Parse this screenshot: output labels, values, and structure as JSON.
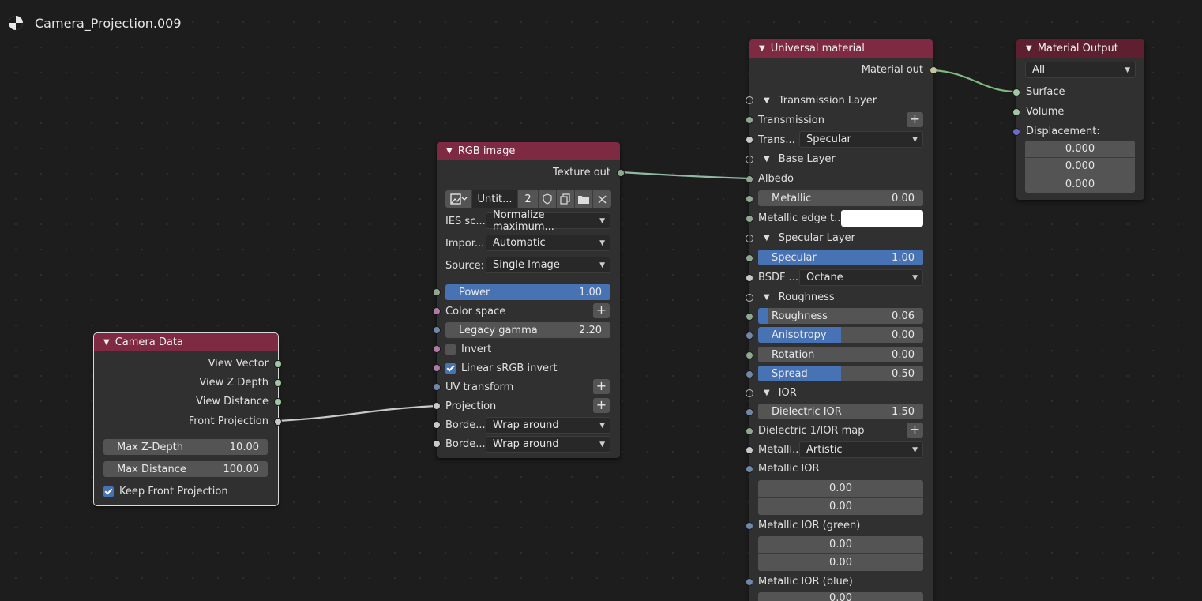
{
  "title": "Camera_Projection.009",
  "colors": {
    "header": "#7e2a42",
    "accent": "#4772b3",
    "wire_green": "#7dbb7d",
    "wire_teal": "#8fb9a5",
    "wire_gray": "#c8c8c8"
  },
  "icons": {
    "material": "material-sphere-icon",
    "collapse": "chevron-down-icon",
    "panel": "triangle-down-icon",
    "add": "plus-icon",
    "check": "checkmark-icon"
  },
  "camera_data": {
    "title": "Camera Data",
    "outputs": [
      "View Vector",
      "View Z Depth",
      "View Distance",
      "Front Projection"
    ],
    "max_z_depth": {
      "label": "Max Z-Depth",
      "value": "10.00"
    },
    "max_distance": {
      "label": "Max Distance",
      "value": "100.00"
    },
    "keep_front_projection": {
      "label": "Keep Front Projection",
      "checked": true
    }
  },
  "rgb_image": {
    "title": "RGB image",
    "output": "Texture out",
    "image_name": "Untit...",
    "users": "2",
    "ies_scale": {
      "label": "IES sc...",
      "value": "Normalize maximum..."
    },
    "import": {
      "label": "Impor...",
      "value": "Automatic"
    },
    "source": {
      "label": "Source:",
      "value": "Single Image"
    },
    "power": {
      "label": "Power",
      "value": "1.00",
      "fill": 1.0
    },
    "color_space": "Color space",
    "legacy_gamma": {
      "label": "Legacy gamma",
      "value": "2.20"
    },
    "invert": {
      "label": "Invert",
      "checked": false
    },
    "linear_srgb_invert": {
      "label": "Linear sRGB invert",
      "checked": true
    },
    "uv_transform": "UV transform",
    "projection": "Projection",
    "border_u": {
      "label": "Borde...",
      "value": "Wrap around"
    },
    "border_v": {
      "label": "Borde...",
      "value": "Wrap around"
    }
  },
  "universal_material": {
    "title": "Universal material",
    "output": "Material out",
    "transmission_layer": "Transmission Layer",
    "transmission": "Transmission",
    "transmission_type": {
      "label": "Trans...",
      "value": "Specular"
    },
    "base_layer": "Base Layer",
    "albedo": "Albedo",
    "metallic": {
      "label": "Metallic",
      "value": "0.00"
    },
    "metallic_edge_tint": "Metallic edge t...",
    "specular_layer": "Specular Layer",
    "specular": {
      "label": "Specular",
      "value": "1.00",
      "fill": 1.0
    },
    "bsdf_model": {
      "label": "BSDF ...",
      "value": "Octane"
    },
    "roughness_panel": "Roughness",
    "roughness": {
      "label": "Roughness",
      "value": "0.06",
      "fill": 0.06
    },
    "anisotropy": {
      "label": "Anisotropy",
      "value": "0.00",
      "fill": 0.5
    },
    "rotation": {
      "label": "Rotation",
      "value": "0.00"
    },
    "spread": {
      "label": "Spread",
      "value": "0.50",
      "fill": 0.5
    },
    "ior_panel": "IOR",
    "dielectric_ior": {
      "label": "Dielectric IOR",
      "value": "1.50"
    },
    "dielectric_ior_map": "Dielectric 1/IOR map",
    "metallic_mode": {
      "label": "Metalli...",
      "value": "Artistic"
    },
    "metallic_ior": {
      "label": "Metallic IOR",
      "values": [
        "0.00",
        "0.00"
      ]
    },
    "metallic_ior_green": {
      "label": "Metallic IOR (green)",
      "values": [
        "0.00",
        "0.00"
      ]
    },
    "metallic_ior_blue": {
      "label": "Metallic IOR (blue)",
      "values": [
        "0.00"
      ]
    }
  },
  "material_output": {
    "title": "Material Output",
    "target": "All",
    "surface": "Surface",
    "volume": "Volume",
    "displacement": "Displacement:",
    "displacement_values": [
      "0.000",
      "0.000",
      "0.000"
    ]
  }
}
